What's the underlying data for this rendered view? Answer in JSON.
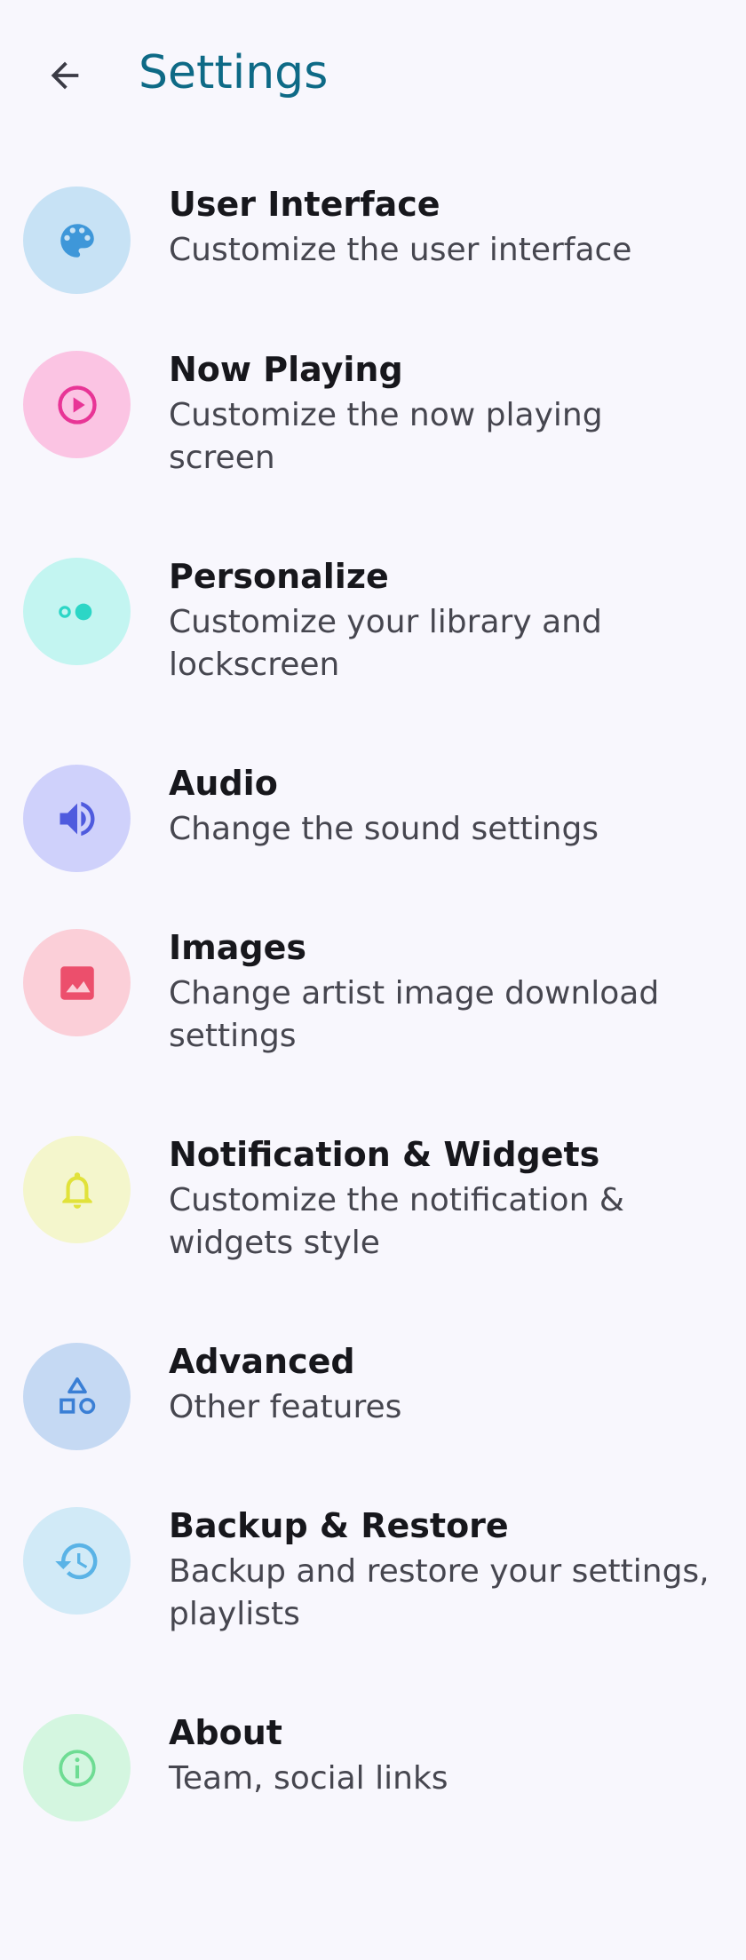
{
  "header": {
    "title": "Settings",
    "back_icon": "arrow-back-icon"
  },
  "items": [
    {
      "title": "User Interface",
      "subtitle": "Customize the user interface",
      "icon": "palette-icon",
      "bg": "#c7e2f5",
      "color": "#3e97d9"
    },
    {
      "title": "Now Playing",
      "subtitle": "Customize the now playing screen",
      "icon": "play-circle-icon",
      "bg": "#fbc4e3",
      "color": "#e83596"
    },
    {
      "title": "Personalize",
      "subtitle": "Customize your library and lockscreen",
      "icon": "toggle-dots-icon",
      "bg": "#c3f5f1",
      "color": "#2cd6c6"
    },
    {
      "title": "Audio",
      "subtitle": "Change the sound settings",
      "icon": "volume-icon",
      "bg": "#cfd1fb",
      "color": "#4f5bde"
    },
    {
      "title": "Images",
      "subtitle": "Change artist image download settings",
      "icon": "image-icon",
      "bg": "#fbcfd8",
      "color": "#ec4f6c"
    },
    {
      "title": "Notification & Widgets",
      "subtitle": "Customize the notification & widgets style",
      "icon": "bell-icon",
      "bg": "#f4f6cc",
      "color": "#e1e23a"
    },
    {
      "title": "Advanced",
      "subtitle": "Other features",
      "icon": "shapes-icon",
      "bg": "#c5d9f3",
      "color": "#3a7fd5"
    },
    {
      "title": "Backup & Restore",
      "subtitle": "Backup and restore your settings, playlists",
      "icon": "restore-clock-icon",
      "bg": "#d1eaf7",
      "color": "#5ab3e6"
    },
    {
      "title": "About",
      "subtitle": "Team, social links",
      "icon": "info-icon",
      "bg": "#d4f6e0",
      "color": "#6edc93"
    }
  ]
}
